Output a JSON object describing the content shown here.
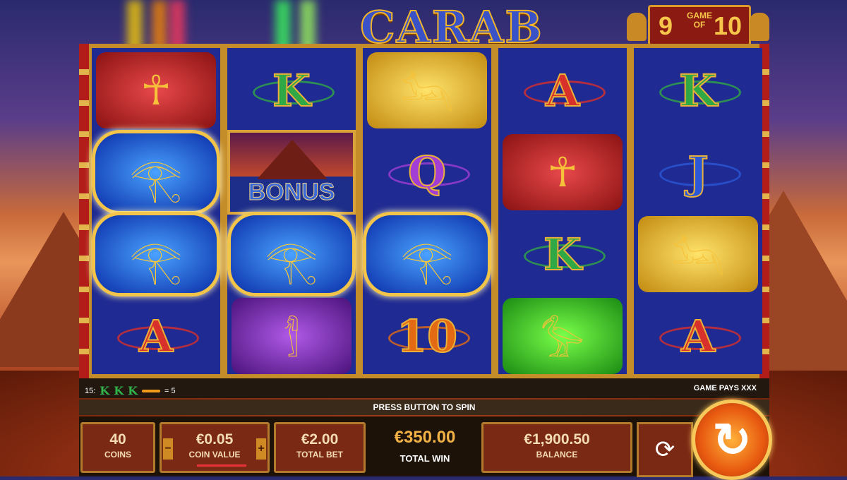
{
  "title": "CARAB",
  "game_counter": {
    "current": "9",
    "of_top": "GAME",
    "of_bottom": "OF",
    "total": "10"
  },
  "colors": {
    "reel_bg": "#1f2a92",
    "accent_gold": "#f2c54a",
    "panel_brown": "#7a2a14",
    "total_win": "#f3b246"
  },
  "reels": [
    [
      {
        "symbol": "ankh-icon",
        "text": ""
      },
      {
        "symbol": "eye-of-horus-icon",
        "text": ""
      },
      {
        "symbol": "eye-of-horus-icon",
        "text": ""
      },
      {
        "symbol": "letter",
        "text": "A",
        "color": "#d8302a"
      }
    ],
    [
      {
        "symbol": "letter",
        "text": "K",
        "color": "#2fa845"
      },
      {
        "symbol": "bonus",
        "text": "BONUS"
      },
      {
        "symbol": "eye-of-horus-icon",
        "text": ""
      },
      {
        "symbol": "pharaoh-sarcophagus-icon",
        "text": ""
      }
    ],
    [
      {
        "symbol": "anubis-jackal-icon",
        "text": ""
      },
      {
        "symbol": "letter",
        "text": "Q",
        "color": "#a23dd6"
      },
      {
        "symbol": "eye-of-horus-icon",
        "text": ""
      },
      {
        "symbol": "letter",
        "text": "10",
        "color": "#e36a12"
      }
    ],
    [
      {
        "symbol": "letter",
        "text": "A",
        "color": "#d8302a"
      },
      {
        "symbol": "ankh-icon",
        "text": ""
      },
      {
        "symbol": "letter",
        "text": "K",
        "color": "#2fa845"
      },
      {
        "symbol": "ibis-bird-icon",
        "text": ""
      }
    ],
    [
      {
        "symbol": "letter",
        "text": "K",
        "color": "#2fa845"
      },
      {
        "symbol": "letter",
        "text": "J",
        "color": "#2a58d8"
      },
      {
        "symbol": "anubis-jackal-icon",
        "text": ""
      },
      {
        "symbol": "letter",
        "text": "A",
        "color": "#d8302a"
      }
    ]
  ],
  "info": {
    "line_number": "15:",
    "line_symbols": [
      "K",
      "K",
      "K"
    ],
    "line_pays": "= 5",
    "game_pays": "GAME PAYS XXX"
  },
  "prompt": "PRESS BUTTON TO SPIN",
  "panel": {
    "coins_value": "40",
    "coins_label": "COINS",
    "coin_value": "€0.05",
    "coin_value_label": "COIN VALUE",
    "total_bet": "€2.00",
    "total_bet_label": "TOTAL BET",
    "total_win": "€350.00",
    "total_win_label": "TOTAL WIN",
    "balance": "€1,900.50",
    "balance_label": "BALANCE",
    "minus": "−",
    "plus": "+"
  }
}
